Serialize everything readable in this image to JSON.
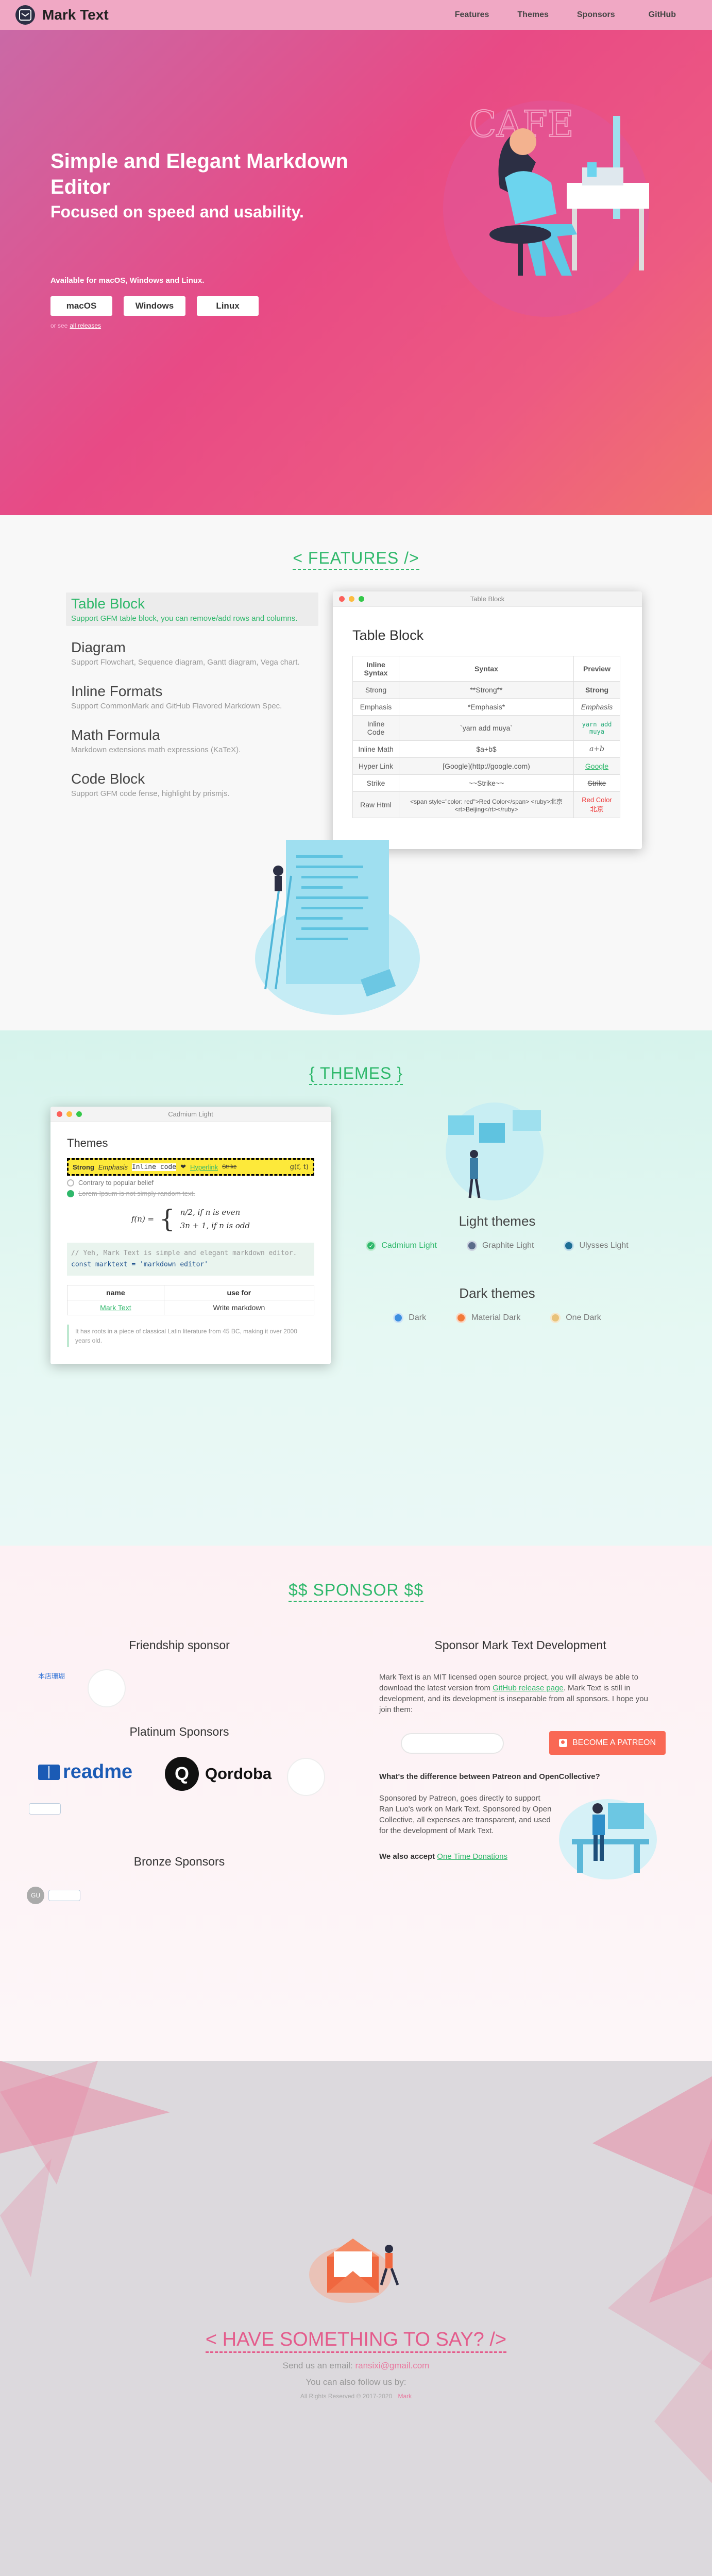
{
  "header": {
    "brand": "Mark Text",
    "nav": [
      "Features",
      "Themes",
      "Sponsors",
      "GitHub"
    ]
  },
  "hero": {
    "title": "Simple and Elegant Markdown Editor",
    "subtitle": "Focused on speed and usability.",
    "availability": "Available for macOS, Windows and Linux.",
    "buttons": [
      "macOS",
      "Windows",
      "Linux"
    ],
    "see_prefix": "or see",
    "see_link": "all releases"
  },
  "features": {
    "section_title": "< FEATURES />",
    "items": [
      {
        "title": "Table Block",
        "desc": "Support GFM table block, you can remove/add rows and columns.",
        "active": true
      },
      {
        "title": "Diagram",
        "desc": "Support Flowchart, Sequence diagram, Gantt diagram, Vega chart."
      },
      {
        "title": "Inline Formats",
        "desc": "Support CommonMark and GitHub Flavored Markdown Spec."
      },
      {
        "title": "Math Formula",
        "desc": "Markdown extensions math expressions (KaTeX)."
      },
      {
        "title": "Code Block",
        "desc": "Support GFM code fense, highlight by prismjs."
      }
    ],
    "window": {
      "title": "Table Block",
      "heading": "Table Block",
      "headers": [
        "Inline Syntax",
        "Syntax",
        "Preview"
      ],
      "rows": [
        [
          "Strong",
          "**Strong**",
          "Strong"
        ],
        [
          "Emphasis",
          "*Emphasis*",
          "Emphasis"
        ],
        [
          "Inline Code",
          "`yarn add muya`",
          "yarn add muya"
        ],
        [
          "Inline Math",
          "$a+b$",
          "a+b"
        ],
        [
          "Hyper Link",
          "[Google](http://google.com)",
          "Google"
        ],
        [
          "Strike",
          "~~Strike~~",
          "Strike"
        ],
        [
          "Raw Html",
          "<span style=\"color: red\">Red Color</span> <ruby>北京<rt>Beijing</rt></ruby>",
          "Red Color 北京"
        ]
      ]
    }
  },
  "themes": {
    "section_title": "{ THEMES }",
    "window": {
      "title": "Cadmium Light",
      "heading": "Themes",
      "hl_strong": "Strong",
      "hl_em": "Emphasis",
      "hl_code": "Inline code",
      "hl_link": "Hyperlink",
      "hl_strike": "Strike",
      "hl_math": "g(f, t)",
      "check1": "Contrary to popular belief",
      "check2": "Lorem Ipsum is not simply random text.",
      "math_lhs": "f(n) =",
      "math_case1": "n/2,   if n is even",
      "math_case2": "3n + 1,   if n is odd",
      "code_comment": "// Yeh, Mark Text is simple and elegant markdown editor.",
      "code_line": "const marktext = 'markdown editor'",
      "table_headers": [
        "name",
        "use for"
      ],
      "table_row": [
        "Mark Text",
        "Write markdown"
      ],
      "quote": "It has roots in a piece of classical Latin literature from 45 BC, making it over 2000 years old."
    },
    "light_title": "Light themes",
    "light": [
      {
        "name": "Cadmium Light",
        "color": "#2fb86b",
        "active": true
      },
      {
        "name": "Graphite Light",
        "color": "#5b6b8a"
      },
      {
        "name": "Ulysses Light",
        "color": "#1f6e95"
      }
    ],
    "dark_title": "Dark themes",
    "dark": [
      {
        "name": "Dark",
        "color": "#3e8fe0"
      },
      {
        "name": "Material Dark",
        "color": "#f27a3a"
      },
      {
        "name": "One Dark",
        "color": "#e8c27a"
      }
    ]
  },
  "sponsor": {
    "section_title": "$$ SPONSOR $$",
    "friendship": "Friendship sponsor",
    "friendship_logo_alt": "本店珊瑚",
    "platinum": "Platinum Sponsors",
    "platinum_logos": [
      "readme",
      "Qordoba"
    ],
    "bronze": "Bronze Sponsors",
    "right_title": "Sponsor Mark Text Development",
    "intro_1": "Mark Text is an MIT licensed open source project, you will always be able to download the latest version from",
    "intro_link": "GitHub release page",
    "intro_2": ". Mark Text is still in development, and its development is inseparable from all sponsors. I hope you join them:",
    "patreon_button": "BECOME A PATREON",
    "question": "What's the difference between Patreon and OpenCollective?",
    "answer": "Sponsored by Patreon, goes directly to support Ran Luo's work on Mark Text. Sponsored by Open Collective, all expenses are transparent, and used for the development of Mark Text.",
    "donation_prefix": "We also accept",
    "donation_link": "One Time Donations"
  },
  "footer": {
    "title": "< HAVE SOMETHING TO SAY? />",
    "email_prefix": "Send us an email:",
    "email": "ransixi@gmail.com",
    "follow": "You can also follow us by:",
    "copyright": "All Rights Reserved © 2017-2020",
    "copyright_link": "Mark"
  }
}
